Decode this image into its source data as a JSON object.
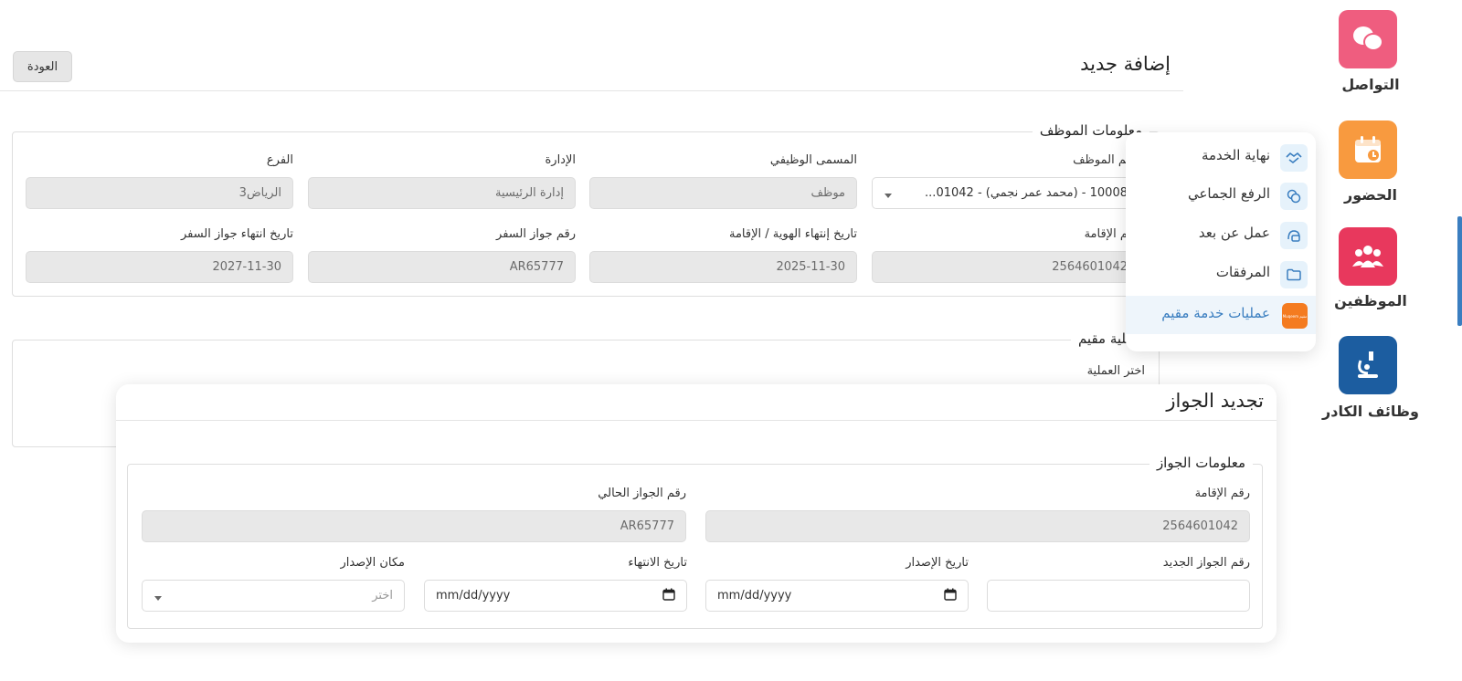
{
  "main": {
    "title": "إضافة جديد",
    "back_label": "العودة",
    "employee_info": {
      "legend": "معلومات الموظف",
      "employee_name": {
        "label": "اسم الموظف",
        "value": "10008 - (محمد عمر نجمي) - 01042..."
      },
      "job_title": {
        "label": "المسمى الوظيفي",
        "value": "موظف"
      },
      "department": {
        "label": "الإدارة",
        "value": "إدارة الرئيسية"
      },
      "branch": {
        "label": "الفرع",
        "value": "الرياض3"
      },
      "iqama_number": {
        "label": "رقم الإقامة",
        "value": "2564601042"
      },
      "id_expiry": {
        "label": "تاريخ إنتهاء الهوية / الإقامة",
        "value": "2025-11-30"
      },
      "passport_number": {
        "label": "رقم جواز السفر",
        "value": "AR65777"
      },
      "passport_expiry": {
        "label": "تاريخ انتهاء جواز السفر",
        "value": "2027-11-30"
      }
    },
    "operation": {
      "legend": "عملية مقيم",
      "select_label": "اختر العملية"
    }
  },
  "side_menu": {
    "items": [
      {
        "label": "التواصل",
        "color": "#ef5d7f"
      },
      {
        "label": "الحضور",
        "color": "#f89a3f"
      },
      {
        "label": "الموظفين",
        "color": "#e8385d",
        "active": true
      },
      {
        "label": "وظائف الكادر",
        "color": "#1c5da0"
      }
    ]
  },
  "popup": {
    "items": [
      {
        "label": "نهاية الخدمة",
        "icon": "handshake-icon"
      },
      {
        "label": "الرفع الجماعي",
        "icon": "copy-icon"
      },
      {
        "label": "عمل عن بعد",
        "icon": "remote-work-icon"
      },
      {
        "label": "المرفقات",
        "icon": "folder-icon"
      },
      {
        "label": "عمليات خدمة مقيم",
        "icon": "muqeem-logo",
        "logo_text": "مقيم Muqeem",
        "active": true
      }
    ]
  },
  "renewal": {
    "title": "تجديد الجواز",
    "legend": "معلومات الجواز",
    "iqama_number": {
      "label": "رقم الإقامة",
      "value": "2564601042"
    },
    "current_passport": {
      "label": "رقم الجواز الحالي",
      "value": "AR65777"
    },
    "new_passport": {
      "label": "رقم الجواز الجديد",
      "value": ""
    },
    "issue_date": {
      "label": "تاريخ الإصدار",
      "placeholder": "mm/dd/yyyy"
    },
    "expiry_date": {
      "label": "تاريخ الانتهاء",
      "placeholder": "mm/dd/yyyy"
    },
    "issue_place": {
      "label": "مكان الإصدار",
      "placeholder": "اختر"
    }
  }
}
